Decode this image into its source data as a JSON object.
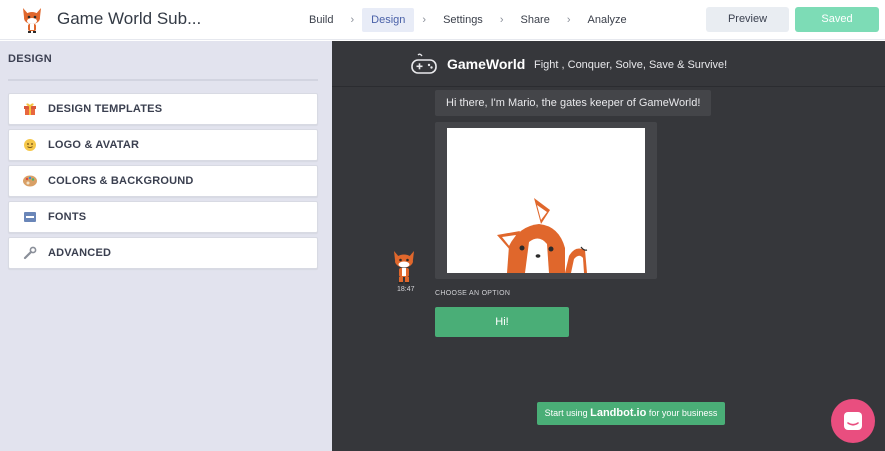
{
  "app": {
    "title": "Game World Sub..."
  },
  "nav": {
    "steps": [
      {
        "label": "Build",
        "active": false
      },
      {
        "label": "Design",
        "active": true
      },
      {
        "label": "Settings",
        "active": false
      },
      {
        "label": "Share",
        "active": false
      },
      {
        "label": "Analyze",
        "active": false
      }
    ],
    "separator": "›",
    "preview_label": "Preview",
    "saved_label": "Saved"
  },
  "sidebar": {
    "title": "DESIGN",
    "items": [
      {
        "label": "DESIGN TEMPLATES",
        "icon": "gift-icon"
      },
      {
        "label": "LOGO & AVATAR",
        "icon": "smiley-icon"
      },
      {
        "label": "COLORS & BACKGROUND",
        "icon": "palette-icon"
      },
      {
        "label": "FONTS",
        "icon": "abc-icon"
      },
      {
        "label": "ADVANCED",
        "icon": "wrench-icon"
      }
    ]
  },
  "preview": {
    "brand": "GameWorld",
    "tagline": "Fight , Conquer, Solve, Save & Survive!",
    "greeting": "Hi there, I'm Mario, the gates keeper of GameWorld!",
    "time": "18:47",
    "choose_label": "CHOOSE AN OPTION",
    "option_label": "Hi!",
    "landbot_prefix": "Start using ",
    "landbot_brand": "Landbot.io",
    "landbot_suffix": " for your business"
  },
  "colors": {
    "accent_green": "#4aae77",
    "saved_green": "#7ddcb6",
    "chat_bg": "#36373b",
    "sidebar_bg": "#e2e3ee",
    "fab_pink": "#e94e7f"
  }
}
